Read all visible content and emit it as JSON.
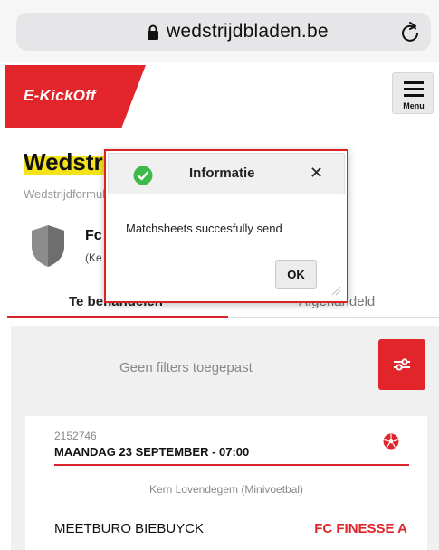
{
  "browser": {
    "url": "wedstrijdbladen.be"
  },
  "header": {
    "logo_text": "E-KickOff",
    "menu_label": "Menu"
  },
  "page": {
    "title": "Wedstrijdbladen",
    "subtitle": "Wedstrijdformulieren",
    "team_name": "Fc",
    "team_sub": "(Ke"
  },
  "tabs": [
    {
      "label": "Te behandelen",
      "active": true
    },
    {
      "label": "Afgehandeld",
      "active": false
    }
  ],
  "filter": {
    "text": "Geen filters toegepast"
  },
  "match": {
    "id": "2152746",
    "date": "MAANDAG 23 SEPTEMBER - 07:00",
    "venue": "Kern Lovendegem (Minivoetbal)",
    "home": "MEETBURO BIEBUYCK",
    "away": "FC FINESSE A"
  },
  "dialog": {
    "title": "Informatie",
    "message": "Matchsheets succesfully send",
    "ok_label": "OK"
  },
  "colors": {
    "brand_red": "#e2242b",
    "highlight_yellow": "#f4e21a",
    "success_green": "#3cba4a"
  },
  "icons": {
    "lock": "lock-icon",
    "reload": "reload-icon",
    "menu": "hamburger-icon",
    "shield": "shield-icon",
    "filter": "filter-sliders-icon",
    "ball": "football-icon",
    "check": "check-circle-icon",
    "close": "close-icon"
  }
}
